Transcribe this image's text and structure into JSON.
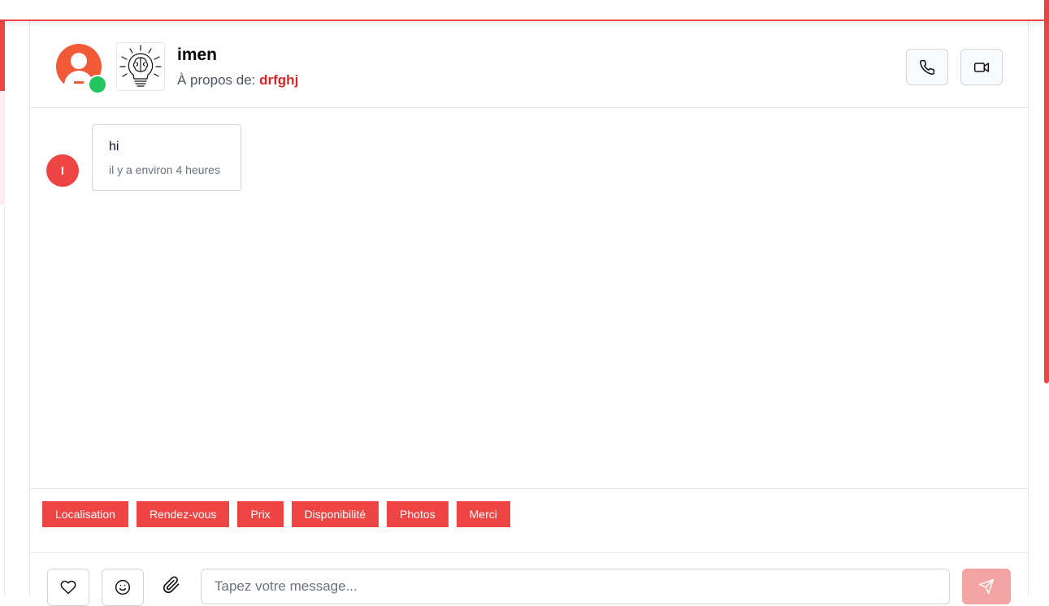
{
  "header": {
    "contact_name": "imen",
    "about_prefix": "À propos de:",
    "listing_name": "drfghj",
    "avatar_icon": "user-avatar-icon",
    "listing_thumb_icon": "lightbulb-brain-icon",
    "status": "online"
  },
  "actions": {
    "call_icon": "phone-icon",
    "video_icon": "video-camera-icon"
  },
  "messages": [
    {
      "avatar_initial": "I",
      "text": "hi",
      "time": "il y a environ 4 heures"
    }
  ],
  "quick_replies": [
    "Localisation",
    "Rendez-vous",
    "Prix",
    "Disponibilité",
    "Photos",
    "Merci"
  ],
  "composer": {
    "placeholder": "Tapez votre message...",
    "heart_icon": "heart-icon",
    "emoji_icon": "smiley-icon",
    "attach_icon": "paperclip-icon",
    "send_icon": "send-icon"
  },
  "colors": {
    "accent": "#ef4444",
    "online": "#22c55e",
    "listing": "#dc2626",
    "avatar": "#f05a37",
    "send_disabled": "#f4a3a3"
  }
}
